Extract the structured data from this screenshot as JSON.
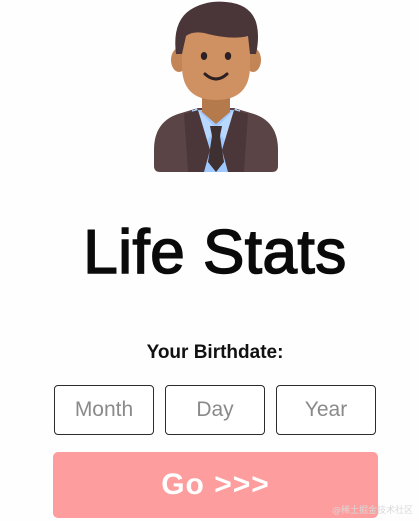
{
  "app": {
    "title": "Life Stats"
  },
  "form": {
    "label": "Your Birthdate:",
    "month": {
      "value": "",
      "placeholder": "Month"
    },
    "day": {
      "value": "",
      "placeholder": "Day"
    },
    "year": {
      "value": "",
      "placeholder": "Year"
    },
    "submit_label": "Go >>>"
  },
  "avatar": {
    "icon": "businessman-avatar-icon"
  },
  "watermark": {
    "text": "@稀土掘金技术社区"
  },
  "colors": {
    "button_bg": "#fe9d9d",
    "button_text": "#ffffff",
    "shirt": "#9fc8ff",
    "suit": "#5a4446",
    "tie": "#3e2f31",
    "skin": "#c98a5a",
    "hair": "#4a3538"
  }
}
